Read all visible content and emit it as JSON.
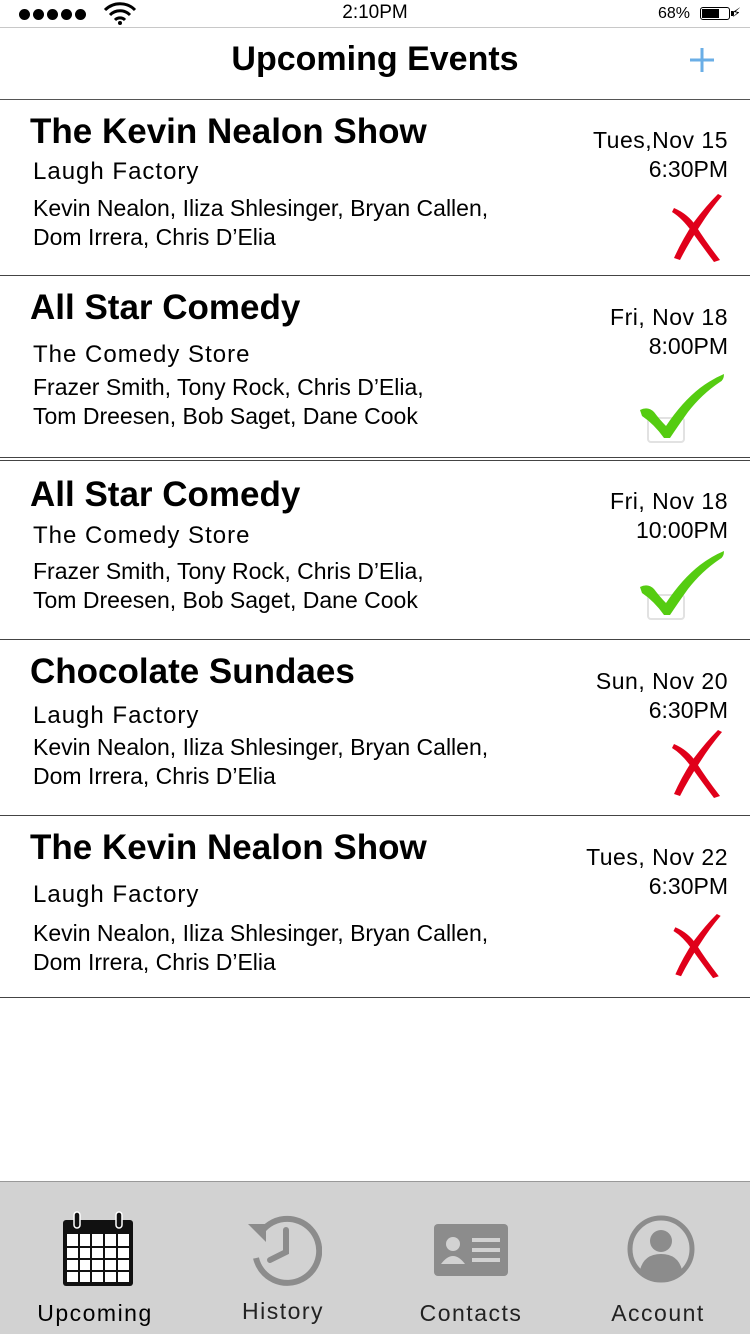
{
  "status_bar": {
    "time": "2:10PM",
    "battery": "68%",
    "battery_level": 0.68,
    "signal_bars": 5,
    "icons": [
      "signal-dots-icon",
      "wifi-icon",
      "battery-icon",
      "charging-bolt-icon"
    ]
  },
  "nav": {
    "title": "Upcoming Events",
    "add_icon": "plus-icon"
  },
  "colors": {
    "accent": "#6aaee6",
    "declined": "#e0001a",
    "accepted": "#55cc11",
    "tab_bar": "#d2d2d2"
  },
  "events": [
    {
      "title": "The Kevin Nealon Show",
      "venue": "Laugh Factory",
      "lineup": [
        "Kevin Nealon, Iliza Shlesinger, Bryan Callen,",
        "Dom Irrera, Chris D’Elia"
      ],
      "date": "Tues,Nov 15",
      "time": "6:30PM",
      "status": "declined",
      "status_icon": "red-x-icon"
    },
    {
      "title": "All Star Comedy",
      "venue": "The Comedy Store",
      "lineup": [
        "Frazer Smith, Tony Rock, Chris D’Elia,",
        "Tom Dreesen, Bob Saget, Dane Cook"
      ],
      "date": "Fri, Nov 18",
      "time": "8:00PM",
      "status": "accepted",
      "status_icon": "green-check-icon"
    },
    {
      "title": "All Star Comedy",
      "venue": "The Comedy Store",
      "lineup": [
        "Frazer Smith, Tony Rock, Chris D’Elia,",
        "Tom Dreesen, Bob Saget, Dane Cook"
      ],
      "date": "Fri, Nov 18",
      "time": "10:00PM",
      "status": "accepted",
      "status_icon": "green-check-icon"
    },
    {
      "title": "Chocolate Sundaes",
      "venue": "Laugh Factory",
      "lineup": [
        "Kevin Nealon, Iliza Shlesinger, Bryan Callen,",
        "Dom Irrera, Chris D’Elia"
      ],
      "date": "Sun, Nov 20",
      "time": "6:30PM",
      "status": "declined",
      "status_icon": "red-x-icon"
    },
    {
      "title": "The Kevin Nealon Show",
      "venue": "Laugh Factory",
      "lineup": [
        "Kevin Nealon, Iliza Shlesinger, Bryan Callen,",
        "Dom Irrera, Chris D’Elia"
      ],
      "date": "Tues, Nov 22",
      "time": "6:30PM",
      "status": "declined",
      "status_icon": "red-x-icon"
    }
  ],
  "tabs": [
    {
      "label": "Upcoming",
      "icon": "calendar-icon",
      "active": true
    },
    {
      "label": "History",
      "icon": "history-clock-icon",
      "active": false
    },
    {
      "label": "Contacts",
      "icon": "contact-card-icon",
      "active": false
    },
    {
      "label": "Account",
      "icon": "account-user-icon",
      "active": false
    }
  ]
}
